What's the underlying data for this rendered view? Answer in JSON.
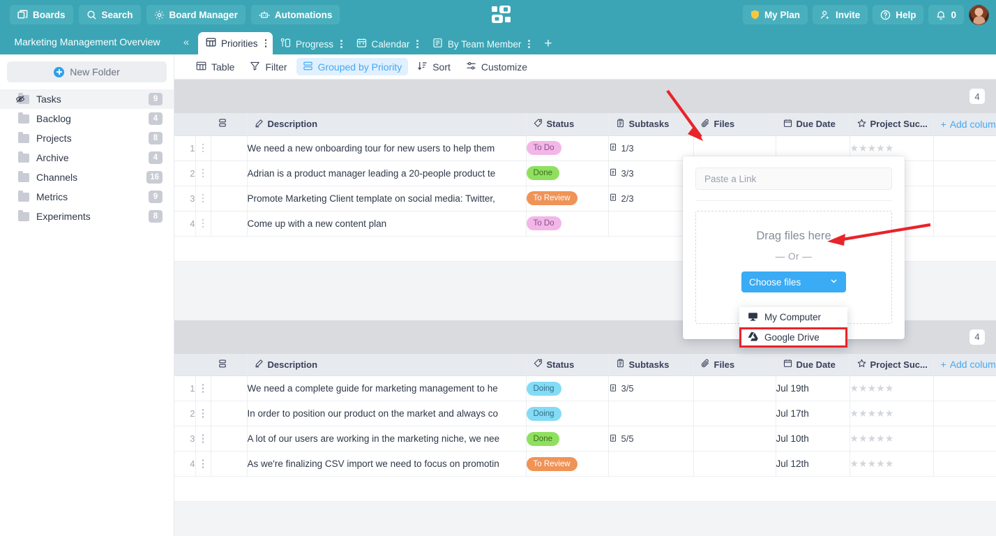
{
  "topbar": {
    "buttons": [
      {
        "label": "Boards",
        "icon": "boards-icon"
      },
      {
        "label": "Search",
        "icon": "search-icon"
      },
      {
        "label": "Board Manager",
        "icon": "gear-icon"
      },
      {
        "label": "Automations",
        "icon": "robot-icon"
      }
    ],
    "logo_icon": "app-logo",
    "right_buttons": [
      {
        "label": "My Plan",
        "icon": "shield-icon"
      },
      {
        "label": "Invite",
        "icon": "user-add-icon"
      },
      {
        "label": "Help",
        "icon": "question-circle-icon"
      },
      {
        "label": "0",
        "icon": "bell-icon"
      }
    ],
    "avatar": "user-avatar",
    "accent_color": "#3ba5b5"
  },
  "sidebar": {
    "board_title": "Marketing Management Overview",
    "new_folder_label": "New Folder",
    "collapse_icon": "chevron-double-left-icon",
    "items": [
      {
        "label": "Tasks",
        "count": "9",
        "icon": "eye-slash-folder-icon",
        "selected": true
      },
      {
        "label": "Backlog",
        "count": "4",
        "icon": "folder-icon",
        "selected": false
      },
      {
        "label": "Projects",
        "count": "8",
        "icon": "folder-icon",
        "selected": false
      },
      {
        "label": "Archive",
        "count": "4",
        "icon": "folder-icon",
        "selected": false
      },
      {
        "label": "Channels",
        "count": "16",
        "icon": "folder-icon",
        "selected": false
      },
      {
        "label": "Metrics",
        "count": "9",
        "icon": "folder-icon",
        "selected": false
      },
      {
        "label": "Experiments",
        "count": "8",
        "icon": "folder-icon",
        "selected": false
      }
    ]
  },
  "tabs": [
    {
      "label": "Priorities",
      "icon": "table-icon",
      "active": true
    },
    {
      "label": "Progress",
      "icon": "kanban-icon",
      "active": false
    },
    {
      "label": "Calendar",
      "icon": "calendar-icon",
      "active": false
    },
    {
      "label": "By Team Member",
      "icon": "list-icon",
      "active": false
    }
  ],
  "tab_add_label": "+",
  "viewbar": [
    {
      "label": "Table",
      "icon": "table-icon",
      "active": false
    },
    {
      "label": "Filter",
      "icon": "filter-icon",
      "active": false
    },
    {
      "label": "Grouped by Priority",
      "icon": "group-icon",
      "active": true
    },
    {
      "label": "Sort",
      "icon": "sort-icon",
      "active": false
    },
    {
      "label": "Customize",
      "icon": "sliders-icon",
      "active": false
    }
  ],
  "columns": [
    {
      "label": "Description",
      "icon": "pencil-icon"
    },
    {
      "label": "Status",
      "icon": "tag-icon"
    },
    {
      "label": "Subtasks",
      "icon": "clipboard-icon"
    },
    {
      "label": "Files",
      "icon": "paperclip-icon"
    },
    {
      "label": "Due Date",
      "icon": "calendar-icon"
    },
    {
      "label": "Project Suc...",
      "icon": "star-icon"
    }
  ],
  "add_column_label": "Add column",
  "groups": [
    {
      "count": "4",
      "rows": [
        {
          "num": "1",
          "description": "We need a new onboarding tour for new users to help them",
          "status": "To Do",
          "status_color": "#f3b6e8",
          "status_text_color": "#8c4d87",
          "subtasks": "1/3",
          "due": "",
          "rating": 0
        },
        {
          "num": "2",
          "description": "Adrian is a product manager leading a 20-people product te",
          "status": "Done",
          "status_color": "#8fe05f",
          "status_text_color": "#3c6b1e",
          "subtasks": "3/3",
          "due": "",
          "rating": 0
        },
        {
          "num": "3",
          "description": "Promote Marketing Client template on social media: Twitter,",
          "status": "To Review",
          "status_color": "#ef9357",
          "status_text_color": "#ffffff",
          "subtasks": "2/3",
          "due": "",
          "rating": 0
        },
        {
          "num": "4",
          "description": "Come up with a new content plan",
          "status": "To Do",
          "status_color": "#f3b6e8",
          "status_text_color": "#8c4d87",
          "subtasks": "",
          "due": "",
          "rating": 0
        }
      ]
    },
    {
      "count": "4",
      "rows": [
        {
          "num": "1",
          "description": "We need a complete guide for marketing management to he",
          "status": "Doing",
          "status_color": "#84dbf5",
          "status_text_color": "#2f6d85",
          "subtasks": "3/5",
          "due": "Jul 19th",
          "rating": 0
        },
        {
          "num": "2",
          "description": "In order to position our product on the market and always co",
          "status": "Doing",
          "status_color": "#84dbf5",
          "status_text_color": "#2f6d85",
          "subtasks": "",
          "due": "Jul 17th",
          "rating": 0
        },
        {
          "num": "3",
          "description": "A lot of our users are working in the marketing niche, we nee",
          "status": "Done",
          "status_color": "#8fe05f",
          "status_text_color": "#3c6b1e",
          "subtasks": "5/5",
          "due": "Jul 10th",
          "rating": 0
        },
        {
          "num": "4",
          "description": "As we're finalizing CSV import we need to focus on promotin",
          "status": "To Review",
          "status_color": "#ef9357",
          "status_text_color": "#ffffff",
          "subtasks": "",
          "due": "Jul 12th",
          "rating": 0
        }
      ]
    }
  ],
  "file_popover": {
    "paste_link_placeholder": "Paste a Link",
    "paste_link_value": "",
    "drag_label": "Drag files here",
    "or_label": "— Or —",
    "choose_files_label": "Choose files",
    "chevron_icon": "chevron-down-icon",
    "menu": [
      {
        "label": "My Computer",
        "icon": "monitor-icon",
        "highlighted": false
      },
      {
        "label": "Google Drive",
        "icon": "google-drive-icon",
        "highlighted": true
      }
    ]
  },
  "annotations": {
    "arrow_color": "#e8242a",
    "highlight_color": "#e8242a"
  }
}
